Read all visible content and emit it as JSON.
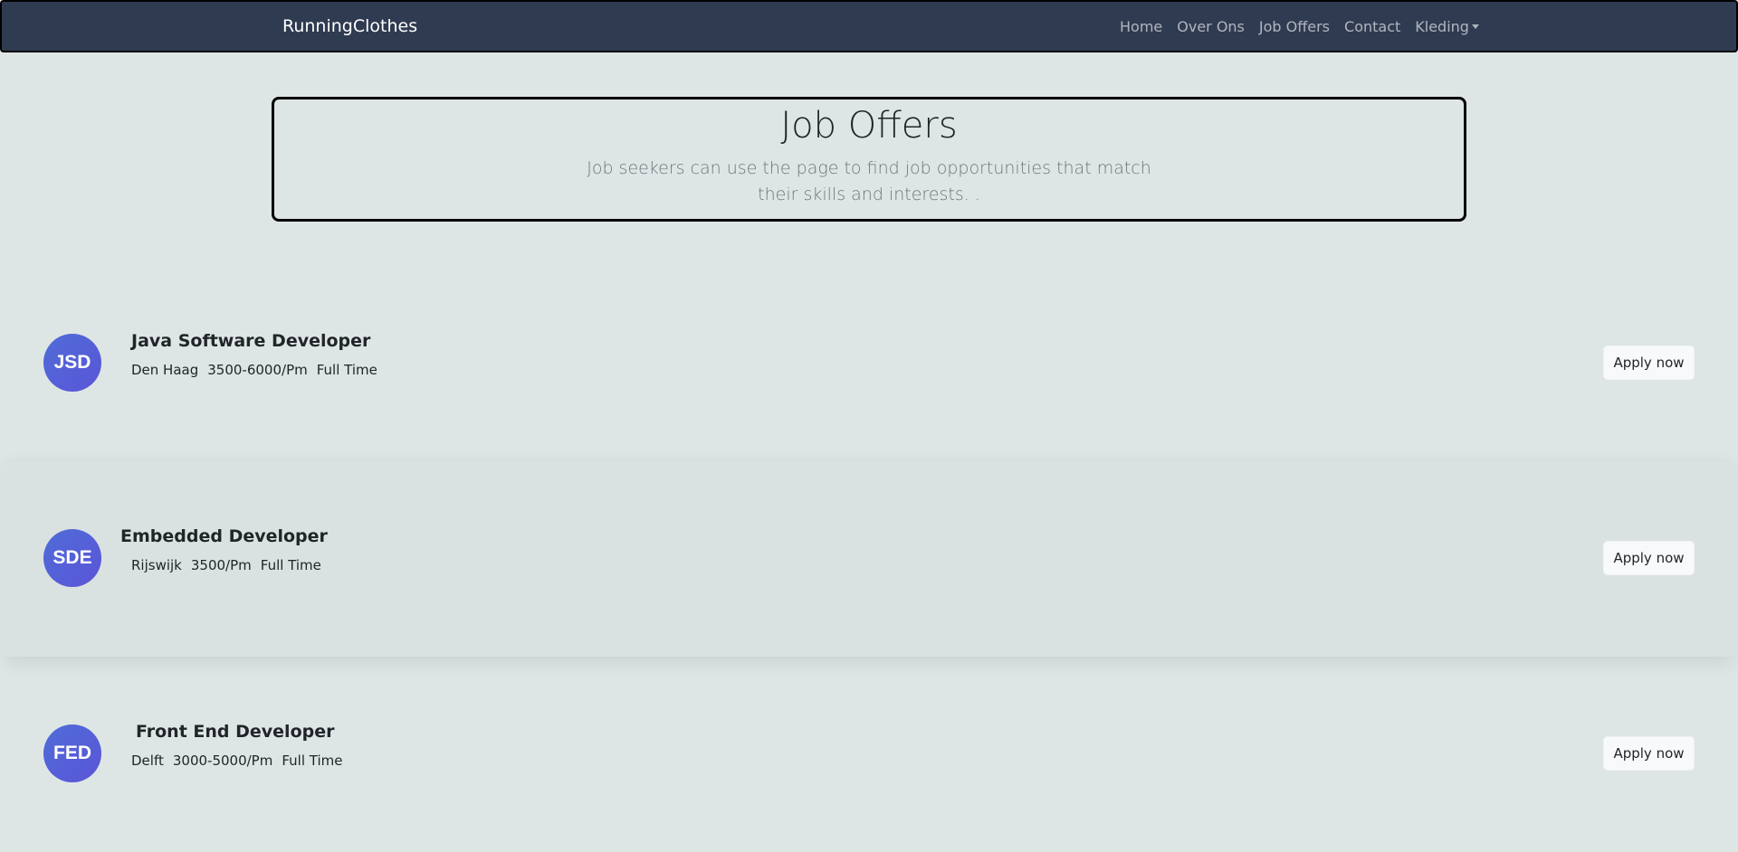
{
  "navbar": {
    "brand": "RunningClothes",
    "links": [
      "Home",
      "Over Ons",
      "Job Offers",
      "Contact",
      "Kleding"
    ]
  },
  "hero": {
    "title": "Job Offers",
    "subtitle": "Job seekers can use the page to find job opportunities that match their skills and interests. ."
  },
  "jobs": [
    {
      "initials": "JSD",
      "title": "Java Software Developer",
      "location": "Den Haag",
      "salary": "3500-6000/Pm",
      "type": "Full Time",
      "button": "Apply now"
    },
    {
      "initials": "SDE",
      "title": "Embedded Developer",
      "location": "Rijswijk",
      "salary": "3500/Pm",
      "type": "Full Time",
      "button": "Apply now"
    },
    {
      "initials": "FED",
      "title": "Front End Developer",
      "location": "Delft",
      "salary": "3000-5000/Pm",
      "type": "Full Time",
      "button": "Apply now"
    }
  ],
  "colors": {
    "navbar_bg": "#2f3b51",
    "page_bg": "#dee6e5",
    "avatar_gradient_start": "#4f6cd9",
    "avatar_gradient_end": "#5b55d6"
  }
}
